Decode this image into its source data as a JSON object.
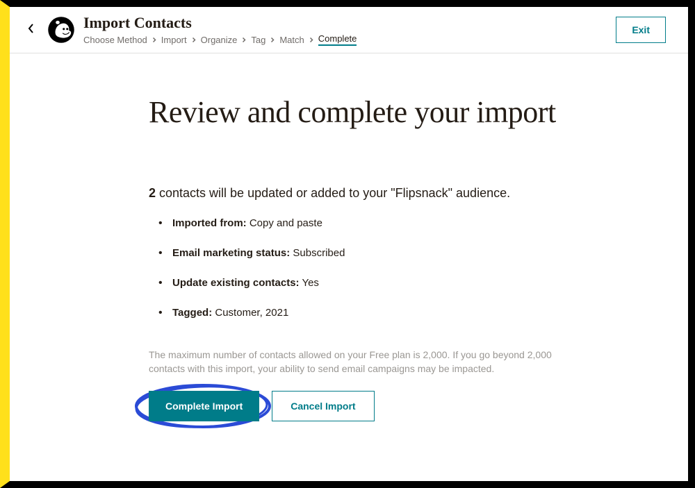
{
  "header": {
    "title": "Import Contacts",
    "breadcrumb": [
      {
        "label": "Choose Method",
        "active": false
      },
      {
        "label": "Import",
        "active": false
      },
      {
        "label": "Organize",
        "active": false
      },
      {
        "label": "Tag",
        "active": false
      },
      {
        "label": "Match",
        "active": false
      },
      {
        "label": "Complete",
        "active": true
      }
    ],
    "exit_label": "Exit"
  },
  "main": {
    "headline": "Review and complete your import",
    "summary": {
      "count": "2",
      "text_rest": " contacts will be updated or added to your \"Flipsnack\" audience."
    },
    "details": {
      "imported_from_label": "Imported from:",
      "imported_from_value": " Copy and paste",
      "status_label": "Email marketing status:",
      "status_value": " Subscribed",
      "update_label": "Update existing contacts:",
      "update_value": " Yes",
      "tagged_label": "Tagged:",
      "tagged_value": " Customer, 2021"
    },
    "disclaimer": "The maximum number of contacts allowed on your Free plan is 2,000. If you go beyond 2,000 contacts with this import, your ability to send email campaigns may be impacted.",
    "actions": {
      "complete_label": "Complete Import",
      "cancel_label": "Cancel Import"
    }
  },
  "colors": {
    "accent": "#007c89",
    "frame_yellow": "#ffe01b",
    "annotation_blue": "#2b4bd6"
  }
}
